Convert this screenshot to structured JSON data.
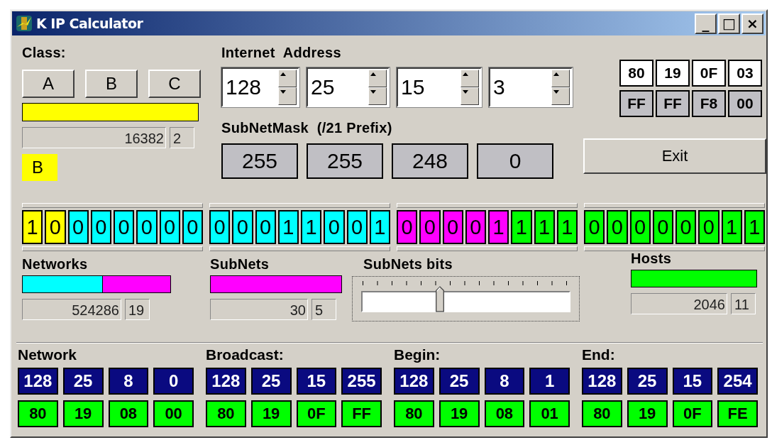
{
  "window": {
    "title": "K IP Calculator",
    "controls": [
      "_",
      "□",
      "×"
    ]
  },
  "class_panel": {
    "label": "Class:",
    "buttons": [
      "A",
      "B",
      "C"
    ],
    "bar": {
      "color": "#ffff00"
    },
    "count": "16382",
    "bits": "2",
    "badge": {
      "text": "B",
      "color": "#ffff00"
    }
  },
  "address": {
    "label": "Internet  Address",
    "octets": [
      "128",
      "25",
      "15",
      "3"
    ]
  },
  "subnet_mask": {
    "label": "SubNetMask  (/21 Prefix)",
    "octets": [
      "255",
      "255",
      "248",
      "0"
    ]
  },
  "address_hex": [
    "80",
    "19",
    "0F",
    "03"
  ],
  "mask_hex": [
    "FF",
    "FF",
    "F8",
    "00"
  ],
  "exit_button": "Exit",
  "bit_octets": [
    {
      "bits": [
        {
          "value": "1",
          "color": "#ffff00"
        },
        {
          "value": "0",
          "color": "#ffff00"
        },
        {
          "value": "0",
          "color": "#00ffff"
        },
        {
          "value": "0",
          "color": "#00ffff"
        },
        {
          "value": "0",
          "color": "#00ffff"
        },
        {
          "value": "0",
          "color": "#00ffff"
        },
        {
          "value": "0",
          "color": "#00ffff"
        },
        {
          "value": "0",
          "color": "#00ffff"
        }
      ]
    },
    {
      "bits": [
        {
          "value": "0",
          "color": "#00ffff"
        },
        {
          "value": "0",
          "color": "#00ffff"
        },
        {
          "value": "0",
          "color": "#00ffff"
        },
        {
          "value": "1",
          "color": "#00ffff"
        },
        {
          "value": "1",
          "color": "#00ffff"
        },
        {
          "value": "0",
          "color": "#00ffff"
        },
        {
          "value": "0",
          "color": "#00ffff"
        },
        {
          "value": "1",
          "color": "#00ffff"
        }
      ]
    },
    {
      "bits": [
        {
          "value": "0",
          "color": "#ff00ff"
        },
        {
          "value": "0",
          "color": "#ff00ff"
        },
        {
          "value": "0",
          "color": "#ff00ff"
        },
        {
          "value": "0",
          "color": "#ff00ff"
        },
        {
          "value": "1",
          "color": "#ff00ff"
        },
        {
          "value": "1",
          "color": "#00ff00"
        },
        {
          "value": "1",
          "color": "#00ff00"
        },
        {
          "value": "1",
          "color": "#00ff00"
        }
      ]
    },
    {
      "bits": [
        {
          "value": "0",
          "color": "#00ff00"
        },
        {
          "value": "0",
          "color": "#00ff00"
        },
        {
          "value": "0",
          "color": "#00ff00"
        },
        {
          "value": "0",
          "color": "#00ff00"
        },
        {
          "value": "0",
          "color": "#00ff00"
        },
        {
          "value": "0",
          "color": "#00ff00"
        },
        {
          "value": "1",
          "color": "#00ff00"
        },
        {
          "value": "1",
          "color": "#00ff00"
        }
      ]
    }
  ],
  "networks": {
    "label": "Networks",
    "segments": [
      {
        "color": "#00ffff",
        "level": 0.54
      },
      {
        "color": "#ff00ff",
        "level": 0.46
      }
    ],
    "count": "524286",
    "bits": "19"
  },
  "subnets": {
    "label": "SubNets",
    "segments": [
      {
        "color": "#ff00ff",
        "level": 1
      }
    ],
    "count": "30",
    "bits": "5"
  },
  "subnet_bits": {
    "label": "SubNets bits",
    "level": 0.37
  },
  "hosts": {
    "label": "Hosts",
    "segments": [
      {
        "color": "#00ff00",
        "level": 1
      }
    ],
    "count": "2046",
    "bits": "11"
  },
  "ranges": [
    {
      "label": "Network",
      "decimal": [
        "128",
        "25",
        "8",
        "0"
      ],
      "hex": [
        "80",
        "19",
        "08",
        "00"
      ]
    },
    {
      "label": "Broadcast:",
      "decimal": [
        "128",
        "25",
        "15",
        "255"
      ],
      "hex": [
        "80",
        "19",
        "0F",
        "FF"
      ]
    },
    {
      "label": "Begin:",
      "decimal": [
        "128",
        "25",
        "8",
        "1"
      ],
      "hex": [
        "80",
        "19",
        "08",
        "01"
      ]
    },
    {
      "label": "End:",
      "decimal": [
        "128",
        "25",
        "15",
        "254"
      ],
      "hex": [
        "80",
        "19",
        "0F",
        "FE"
      ]
    }
  ]
}
